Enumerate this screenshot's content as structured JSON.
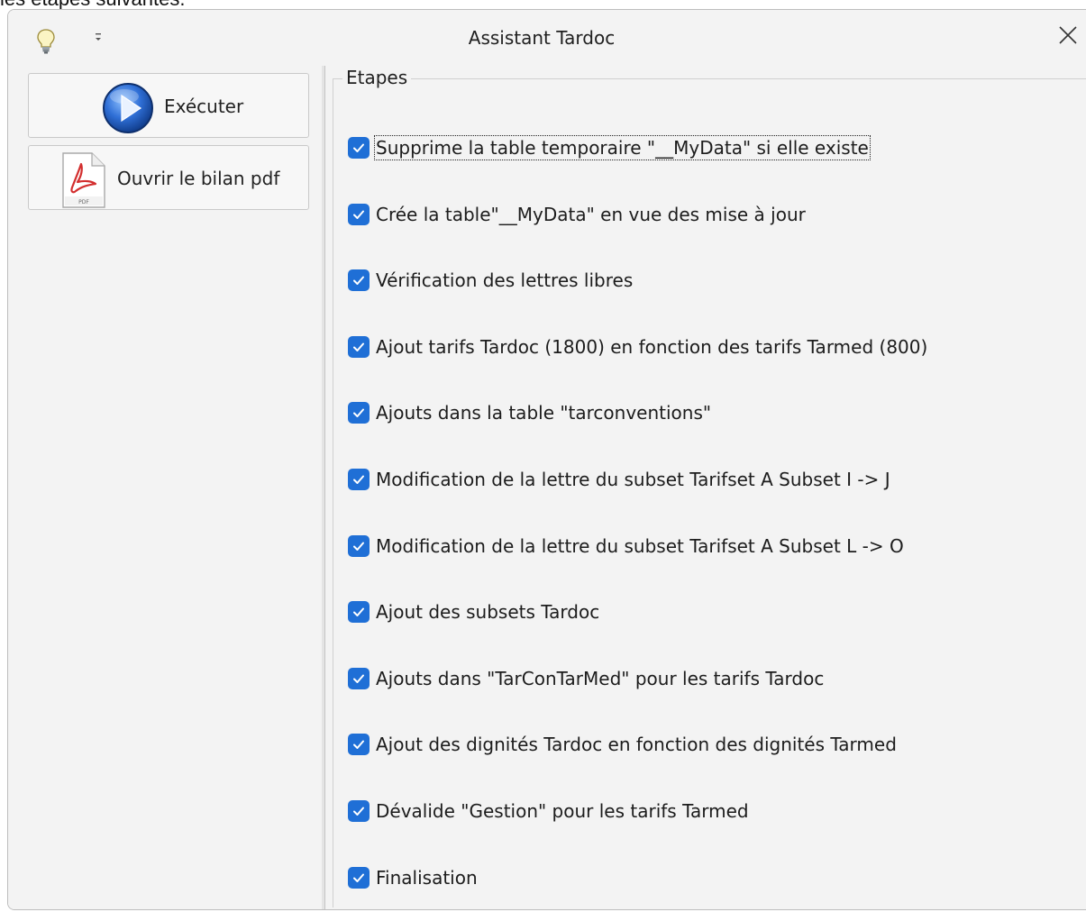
{
  "background_text": "les étapes suivantes.",
  "window": {
    "title": "Assistant Tardoc",
    "icons": {
      "app": "lightbulb-icon",
      "quick_access": "customize-quick-access-icon",
      "close": "close-icon"
    }
  },
  "sidebar": {
    "run_button": {
      "label": "Exécuter",
      "icon": "play-icon"
    },
    "pdf_button": {
      "label": "Ouvrir le bilan pdf",
      "icon": "pdf-file-icon",
      "icon_caption": "PDF"
    }
  },
  "steps_group": {
    "legend": "Etapes",
    "steps": [
      {
        "label": "Supprime la table temporaire \"__MyData\" si elle existe",
        "checked": true,
        "focused": true
      },
      {
        "label": "Crée la table\"__MyData\" en vue des mise à  jour",
        "checked": true
      },
      {
        "label": "Vérification des lettres libres",
        "checked": true
      },
      {
        "label": "Ajout tarifs Tardoc (1800) en fonction des tarifs Tarmed (800)",
        "checked": true
      },
      {
        "label": "Ajouts dans la table \"tarconventions\"",
        "checked": true
      },
      {
        "label": "Modification de la lettre du subset  Tarifset A Subset I -> J",
        "checked": true
      },
      {
        "label": "Modification de la lettre du subset  Tarifset A Subset L -> O",
        "checked": true
      },
      {
        "label": "Ajout des subsets Tardoc",
        "checked": true
      },
      {
        "label": "Ajouts dans \"TarConTarMed\" pour les tarifs Tardoc",
        "checked": true
      },
      {
        "label": "Ajout des dignités Tardoc en fonction des dignités Tarmed",
        "checked": true
      },
      {
        "label": "Dévalide \"Gestion\" pour les tarifs Tarmed",
        "checked": true
      },
      {
        "label": "Finalisation",
        "checked": true
      }
    ]
  },
  "colors": {
    "checkbox": "#1f6fd6",
    "window_bg": "#f3f3f3"
  }
}
